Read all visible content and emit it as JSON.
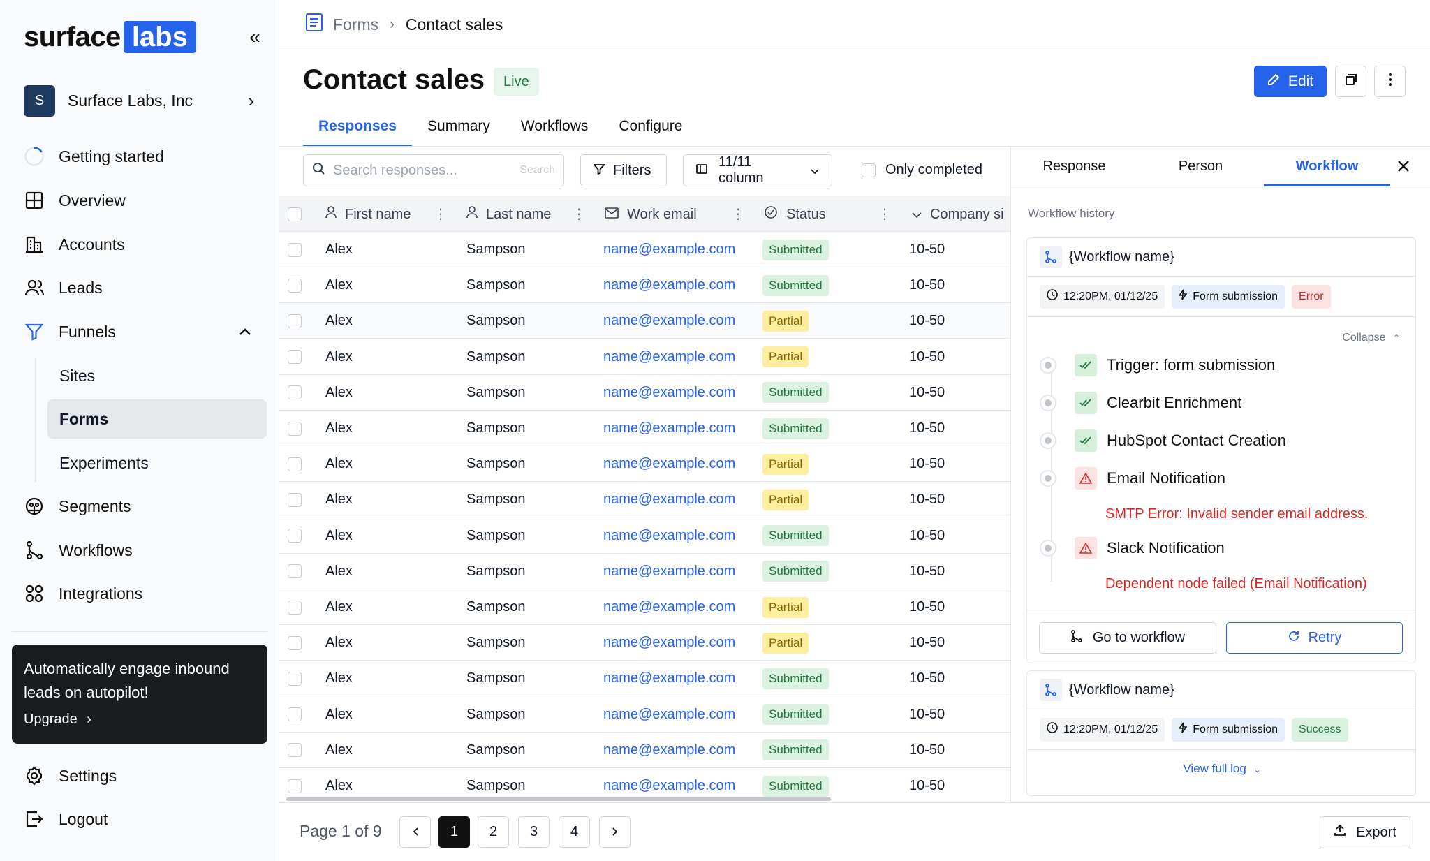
{
  "brand": {
    "name": "surface",
    "box": "labs",
    "accent": "#2563eb"
  },
  "org": {
    "initial": "S",
    "name": "Surface Labs, Inc"
  },
  "nav": {
    "getting_started": "Getting started",
    "overview": "Overview",
    "accounts": "Accounts",
    "leads": "Leads",
    "funnels": "Funnels",
    "sites": "Sites",
    "forms": "Forms",
    "experiments": "Experiments",
    "segments": "Segments",
    "workflows": "Workflows",
    "integrations": "Integrations",
    "settings": "Settings",
    "logout": "Logout"
  },
  "promo": {
    "text": "Automatically engage inbound leads on autopilot!",
    "link": "Upgrade"
  },
  "breadcrumb": {
    "parent": "Forms",
    "current": "Contact sales"
  },
  "page": {
    "title": "Contact sales",
    "status": "Live",
    "edit_label": "Edit"
  },
  "tabs": [
    "Responses",
    "Summary",
    "Workflows",
    "Configure"
  ],
  "toolbar": {
    "search_placeholder": "Search responses...",
    "search_hint": "Search",
    "filters": "Filters",
    "columns": "11/11 column",
    "only_completed": "Only completed"
  },
  "table": {
    "headers": [
      "First name",
      "Last name",
      "Work email",
      "Status",
      "Company si"
    ],
    "rows": [
      [
        "Alex",
        "Sampson",
        "name@example.com",
        "Submitted",
        "10-50"
      ],
      [
        "Alex",
        "Sampson",
        "name@example.com",
        "Submitted",
        "10-50"
      ],
      [
        "Alex",
        "Sampson",
        "name@example.com",
        "Partial",
        "10-50"
      ],
      [
        "Alex",
        "Sampson",
        "name@example.com",
        "Partial",
        "10-50"
      ],
      [
        "Alex",
        "Sampson",
        "name@example.com",
        "Submitted",
        "10-50"
      ],
      [
        "Alex",
        "Sampson",
        "name@example.com",
        "Submitted",
        "10-50"
      ],
      [
        "Alex",
        "Sampson",
        "name@example.com",
        "Partial",
        "10-50"
      ],
      [
        "Alex",
        "Sampson",
        "name@example.com",
        "Partial",
        "10-50"
      ],
      [
        "Alex",
        "Sampson",
        "name@example.com",
        "Submitted",
        "10-50"
      ],
      [
        "Alex",
        "Sampson",
        "name@example.com",
        "Submitted",
        "10-50"
      ],
      [
        "Alex",
        "Sampson",
        "name@example.com",
        "Partial",
        "10-50"
      ],
      [
        "Alex",
        "Sampson",
        "name@example.com",
        "Partial",
        "10-50"
      ],
      [
        "Alex",
        "Sampson",
        "name@example.com",
        "Submitted",
        "10-50"
      ],
      [
        "Alex",
        "Sampson",
        "name@example.com",
        "Submitted",
        "10-50"
      ],
      [
        "Alex",
        "Sampson",
        "name@example.com",
        "Submitted",
        "10-50"
      ],
      [
        "Alex",
        "Sampson",
        "name@example.com",
        "Submitted",
        "10-50"
      ]
    ]
  },
  "pagination": {
    "info": "Page 1 of 9",
    "pages": [
      "1",
      "2",
      "3",
      "4"
    ],
    "export": "Export"
  },
  "panel": {
    "tabs": [
      "Response",
      "Person",
      "Workflow"
    ],
    "history_label": "Workflow history",
    "card1": {
      "name": "{Workflow name}",
      "time": "12:20PM, 01/12/25",
      "trigger": "Form submission",
      "status": "Error",
      "collapse": "Collapse",
      "steps": [
        {
          "label": "Trigger: form submission",
          "state": "ok"
        },
        {
          "label": "Clearbit Enrichment",
          "state": "ok"
        },
        {
          "label": "HubSpot Contact Creation",
          "state": "ok"
        },
        {
          "label": "Email Notification",
          "state": "error",
          "error": "SMTP Error: Invalid sender email address."
        },
        {
          "label": "Slack Notification",
          "state": "error",
          "error": "Dependent node failed (Email Notification)"
        }
      ],
      "goto": "Go to workflow",
      "retry": "Retry"
    },
    "card2": {
      "name": "{Workflow name}",
      "time": "12:20PM, 01/12/25",
      "trigger": "Form submission",
      "status": "Success",
      "view_log": "View full log"
    }
  }
}
